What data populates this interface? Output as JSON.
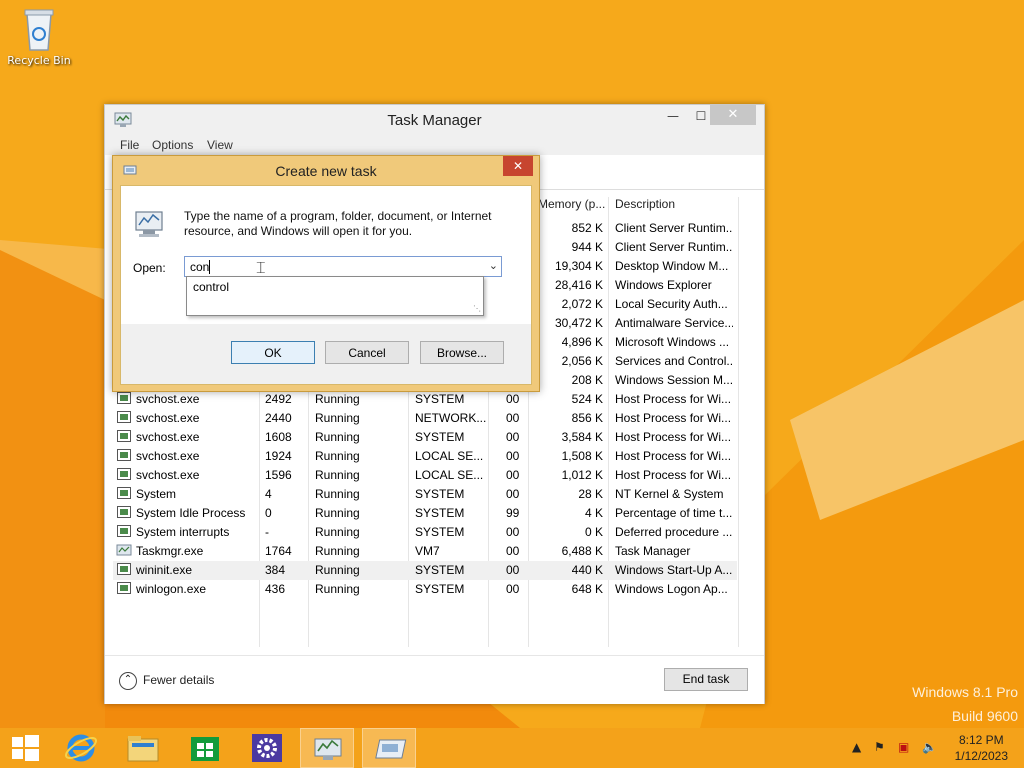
{
  "desktop": {
    "recycle_bin_label": "Recycle Bin",
    "watermark_line1": "Windows 8.1 Pro",
    "watermark_line2": "Build 9600",
    "accent": "#f5a818"
  },
  "task_manager": {
    "title": "Task Manager",
    "menu": [
      "File",
      "Options",
      "View"
    ],
    "columns": {
      "memory": "Memory (p...",
      "description": "Description"
    },
    "hidden_rows": [
      {
        "memory": "852 K",
        "description": "Client Server Runtim..."
      },
      {
        "memory": "944 K",
        "description": "Client Server Runtim..."
      },
      {
        "memory": "19,304 K",
        "description": "Desktop Window M..."
      },
      {
        "memory": "28,416 K",
        "description": "Windows Explorer"
      },
      {
        "memory": "2,072 K",
        "description": "Local Security Auth..."
      },
      {
        "memory": "30,472 K",
        "description": "Antimalware Service..."
      },
      {
        "memory": "4,896 K",
        "description": "Microsoft Windows ..."
      },
      {
        "memory": "2,056 K",
        "description": "Services and Control..."
      },
      {
        "memory": "208 K",
        "description": "Windows Session M..."
      }
    ],
    "rows": [
      {
        "name": "svchost.exe",
        "pid": "2492",
        "status": "Running",
        "user": "SYSTEM",
        "cpu": "00",
        "memory": "524 K",
        "description": "Host Process for Wi..."
      },
      {
        "name": "svchost.exe",
        "pid": "2440",
        "status": "Running",
        "user": "NETWORK...",
        "cpu": "00",
        "memory": "856 K",
        "description": "Host Process for Wi..."
      },
      {
        "name": "svchost.exe",
        "pid": "1608",
        "status": "Running",
        "user": "SYSTEM",
        "cpu": "00",
        "memory": "3,584 K",
        "description": "Host Process for Wi..."
      },
      {
        "name": "svchost.exe",
        "pid": "1924",
        "status": "Running",
        "user": "LOCAL SE...",
        "cpu": "00",
        "memory": "1,508 K",
        "description": "Host Process for Wi..."
      },
      {
        "name": "svchost.exe",
        "pid": "1596",
        "status": "Running",
        "user": "LOCAL SE...",
        "cpu": "00",
        "memory": "1,012 K",
        "description": "Host Process for Wi..."
      },
      {
        "name": "System",
        "pid": "4",
        "status": "Running",
        "user": "SYSTEM",
        "cpu": "00",
        "memory": "28 K",
        "description": "NT Kernel & System"
      },
      {
        "name": "System Idle Process",
        "pid": "0",
        "status": "Running",
        "user": "SYSTEM",
        "cpu": "99",
        "memory": "4 K",
        "description": "Percentage of time t..."
      },
      {
        "name": "System interrupts",
        "pid": "-",
        "status": "Running",
        "user": "SYSTEM",
        "cpu": "00",
        "memory": "0 K",
        "description": "Deferred procedure ..."
      },
      {
        "name": "Taskmgr.exe",
        "pid": "1764",
        "status": "Running",
        "user": "VM7",
        "cpu": "00",
        "memory": "6,488 K",
        "description": "Task Manager"
      },
      {
        "name": "wininit.exe",
        "pid": "384",
        "status": "Running",
        "user": "SYSTEM",
        "cpu": "00",
        "memory": "440 K",
        "description": "Windows Start-Up A..."
      },
      {
        "name": "winlogon.exe",
        "pid": "436",
        "status": "Running",
        "user": "SYSTEM",
        "cpu": "00",
        "memory": "648 K",
        "description": "Windows Logon Ap..."
      }
    ],
    "fewer_details": "Fewer details",
    "end_task": "End task"
  },
  "run_dialog": {
    "title": "Create new task",
    "description": "Type the name of a program, folder, document, or Internet resource, and Windows will open it for you.",
    "open_label": "Open:",
    "input_value": "con",
    "suggestion": "control",
    "ok": "OK",
    "cancel": "Cancel",
    "browse": "Browse..."
  },
  "taskbar": {
    "time": "8:12 PM",
    "date": "1/12/2023",
    "icons": [
      "start-icon",
      "internet-explorer-icon",
      "file-explorer-icon",
      "store-icon",
      "settings-icon",
      "task-manager-icon",
      "run-dialog-icon"
    ]
  }
}
